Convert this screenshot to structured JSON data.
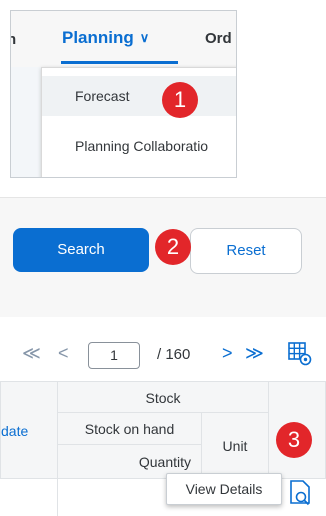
{
  "nav": {
    "tab_left_fragment": "n",
    "tab_planning": "Planning",
    "tab_right_fragment": "Ord",
    "menu_items": [
      "Forecast",
      "Planning Collaboratio"
    ]
  },
  "badges": [
    "1",
    "2",
    "3"
  ],
  "actions": {
    "search_label": "Search",
    "reset_label": "Reset"
  },
  "pagination": {
    "current_page": "1",
    "total_pages": "/ 160"
  },
  "table": {
    "col_date_fragment": "date",
    "group_header": "Stock",
    "sub_header": "Stock on hand",
    "quantity_label": "Quantity",
    "unit_label": "Unit"
  },
  "tooltip": "View Details",
  "colors": {
    "accent": "#0a6ed1",
    "badge": "#e2262a"
  }
}
